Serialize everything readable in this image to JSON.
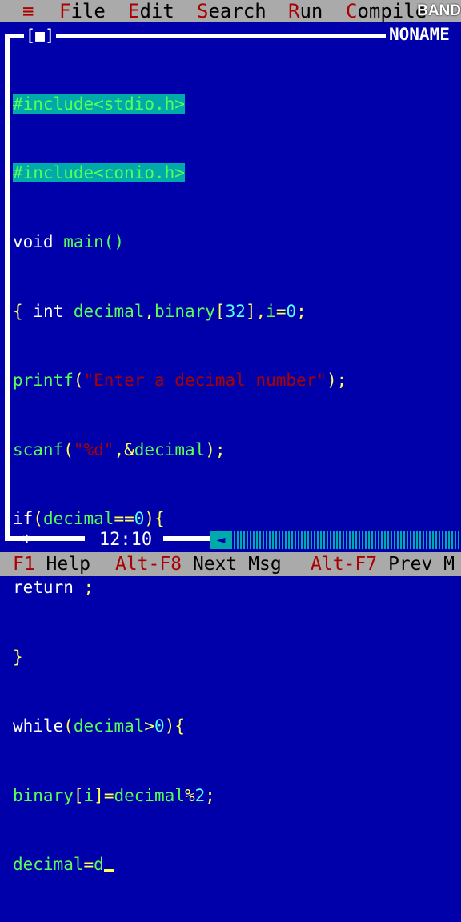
{
  "menu": {
    "system_icon": "≡",
    "items": [
      {
        "hot": "F",
        "rest": "ile"
      },
      {
        "hot": "E",
        "rest": "dit"
      },
      {
        "hot": "S",
        "rest": "earch"
      },
      {
        "hot": "R",
        "rest": "un"
      },
      {
        "hot": "C",
        "rest": "ompile"
      }
    ]
  },
  "watermark": "BAND",
  "window": {
    "close_icon": "[■]",
    "title": "NONAME"
  },
  "code": {
    "l1": "#include<stdio.h>",
    "l2": "#include<conio.h>",
    "l3_kw": "void",
    "l3_id": " main()",
    "l4_a": "{ ",
    "l4_kw": "int",
    "l4_id1": " decimal",
    "l4_sy1": ",",
    "l4_id2": "binary",
    "l4_sy2": "[",
    "l4_n1": "32",
    "l4_sy3": "],",
    "l4_id3": "i",
    "l4_sy4": "=",
    "l4_n2": "0",
    "l4_sy5": ";",
    "l5_id": "printf",
    "l5_sy1": "(",
    "l5_str": "\"Enter a decimal number\"",
    "l5_sy2": ");",
    "l6_id": "scanf",
    "l6_sy1": "(",
    "l6_str": "\"%d\"",
    "l6_sy2": ",&",
    "l6_id2": "decimal",
    "l6_sy3": ");",
    "l7_kw": "if",
    "l7_sy1": "(",
    "l7_id": "decimal",
    "l7_sy2": "==",
    "l7_n": "0",
    "l7_sy3": "){",
    "l8_kw": "return",
    "l8_sy": " ;",
    "l9": "}",
    "l10_kw": "while",
    "l10_sy1": "(",
    "l10_id": "decimal",
    "l10_sy2": ">",
    "l10_n": "0",
    "l10_sy3": "){",
    "l11_id": "binary",
    "l11_sy1": "[",
    "l11_id2": "i",
    "l11_sy2": "]=",
    "l11_id3": "decimal",
    "l11_sy3": "%",
    "l11_n": "2",
    "l11_sy4": ";",
    "l12_id": "decimal",
    "l12_sy": "=",
    "l12_id2": "d"
  },
  "status": {
    "position": "12:10",
    "items": [
      {
        "key": "F1",
        "label": " Help"
      },
      {
        "key": "Alt-F8",
        "label": " Next Msg"
      },
      {
        "key": "Alt-F7",
        "label": " Prev M"
      }
    ]
  }
}
